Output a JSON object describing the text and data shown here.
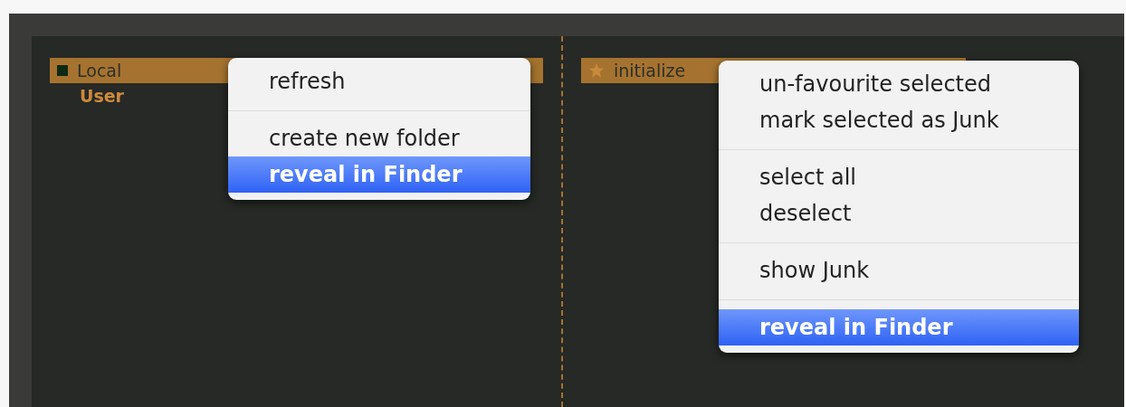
{
  "left_panel": {
    "items": [
      {
        "label": "Local",
        "selected": true,
        "children": [
          {
            "label": "User",
            "selected": false
          }
        ]
      }
    ]
  },
  "left_menu": {
    "groups": [
      [
        {
          "label": "refresh",
          "selected": false
        }
      ],
      [
        {
          "label": "create new folder",
          "selected": false
        },
        {
          "label": "reveal in Finder",
          "selected": true
        }
      ]
    ]
  },
  "right_panel": {
    "items": [
      {
        "label": "initialize",
        "selected": true
      }
    ]
  },
  "right_menu": {
    "groups": [
      [
        {
          "label": "un-favourite selected",
          "selected": false
        },
        {
          "label": "mark selected as Junk",
          "selected": false
        }
      ],
      [
        {
          "label": "select all",
          "selected": false
        },
        {
          "label": "deselect",
          "selected": false
        }
      ],
      [
        {
          "label": "show Junk",
          "selected": false
        }
      ],
      [
        {
          "label": "reveal in Finder",
          "selected": true
        }
      ]
    ]
  }
}
